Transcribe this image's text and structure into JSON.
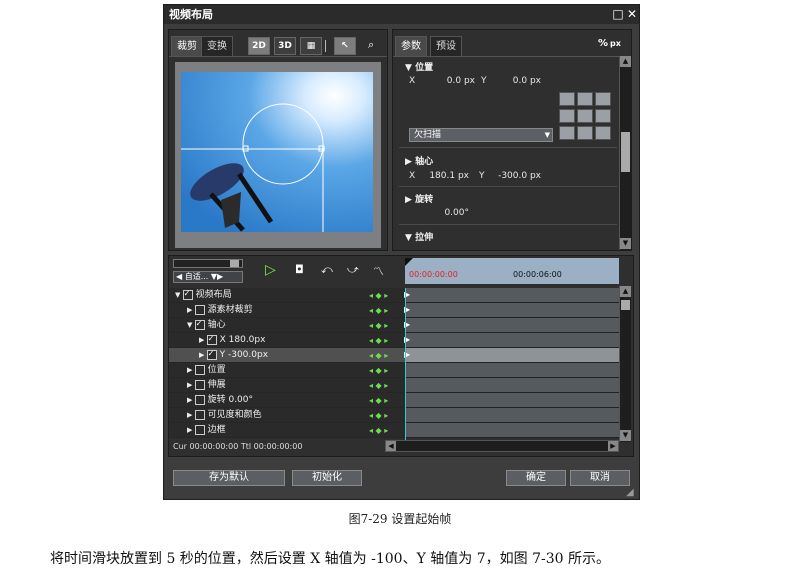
{
  "window": {
    "title": "视频布局"
  },
  "preview": {
    "tabs": [
      "裁剪",
      "变换"
    ],
    "tools": [
      "2D",
      "3D"
    ],
    "select_label": "自适..."
  },
  "params": {
    "tabs": [
      "参数",
      "预设"
    ],
    "unit": "px",
    "position": {
      "title": "位置",
      "x_label": "X",
      "x": "0.0 px",
      "y_label": "Y",
      "y": "0.0 px"
    },
    "dropdown": "欠扫描",
    "pivot": {
      "title": "轴心",
      "x_label": "X",
      "x": "180.1 px",
      "y_label": "Y",
      "y": "-300.0 px"
    },
    "rotation": {
      "title": "旋转",
      "value": "0.00°"
    },
    "stretch": {
      "title": "拉伸"
    }
  },
  "timeline": {
    "time_start": "00:00:00:00",
    "time_mark": "00:00:06:00",
    "rows": [
      {
        "label": "视频布局",
        "indent": 0,
        "checked": true,
        "arrow": "▼"
      },
      {
        "label": "源素材裁剪",
        "indent": 1,
        "checked": false,
        "arrow": "▶"
      },
      {
        "label": "轴心",
        "indent": 1,
        "checked": true,
        "arrow": "▼"
      },
      {
        "label": "X  180.0px",
        "indent": 2,
        "checked": true,
        "arrow": "▶"
      },
      {
        "label": "Y  -300.0px",
        "indent": 2,
        "checked": true,
        "arrow": "▶"
      },
      {
        "label": "位置",
        "indent": 1,
        "checked": false,
        "arrow": "▶"
      },
      {
        "label": "伸展",
        "indent": 1,
        "checked": false,
        "arrow": "▶"
      },
      {
        "label": "旋转  0.00°",
        "indent": 1,
        "checked": false,
        "arrow": "▶"
      },
      {
        "label": "可见度和颜色",
        "indent": 1,
        "checked": false,
        "arrow": "▶"
      },
      {
        "label": "边框",
        "indent": 1,
        "checked": false,
        "arrow": "▶"
      }
    ],
    "status": "Cur 00:00:00:00 Ttl 00:00:00:00"
  },
  "buttons": {
    "save_default": "存为默认",
    "init": "初始化",
    "ok": "确定",
    "cancel": "取消"
  },
  "caption": {
    "figure": "图7-29    设置起始帧",
    "body": "将时间滑块放置到 5 秒的位置，然后设置 X 轴值为 -100、Y 轴值为 7，如图 7-30 所示。"
  }
}
